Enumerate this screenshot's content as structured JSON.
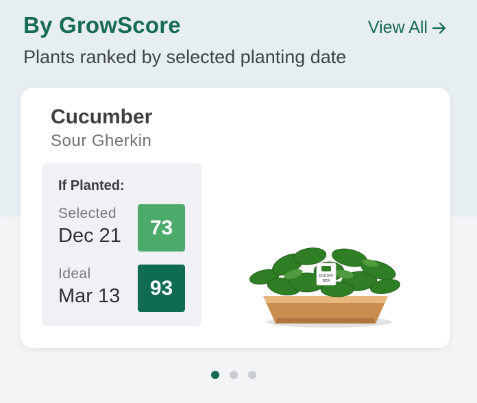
{
  "section": {
    "title": "By GrowScore",
    "view_all_label": "View All",
    "subtitle": "Plants ranked by selected planting date"
  },
  "card": {
    "plant_name": "Cucumber",
    "variety": "Sour Gherkin",
    "panel_heading": "If Planted:",
    "selected": {
      "label": "Selected",
      "date": "Dec 21",
      "score": "73",
      "color": "#4caa6a"
    },
    "ideal": {
      "label": "Ideal",
      "date": "Mar 13",
      "score": "93",
      "color": "#0f6b52"
    },
    "image_icon": "cucumber-plant-in-wooden-tray",
    "plant_tag_text": "CUCUM-BER"
  },
  "pagination": {
    "count": 3,
    "active_index": 0
  },
  "colors": {
    "brand_green": "#176b52",
    "background_top": "#e7eef1",
    "background_bottom": "#f3f4f5"
  }
}
